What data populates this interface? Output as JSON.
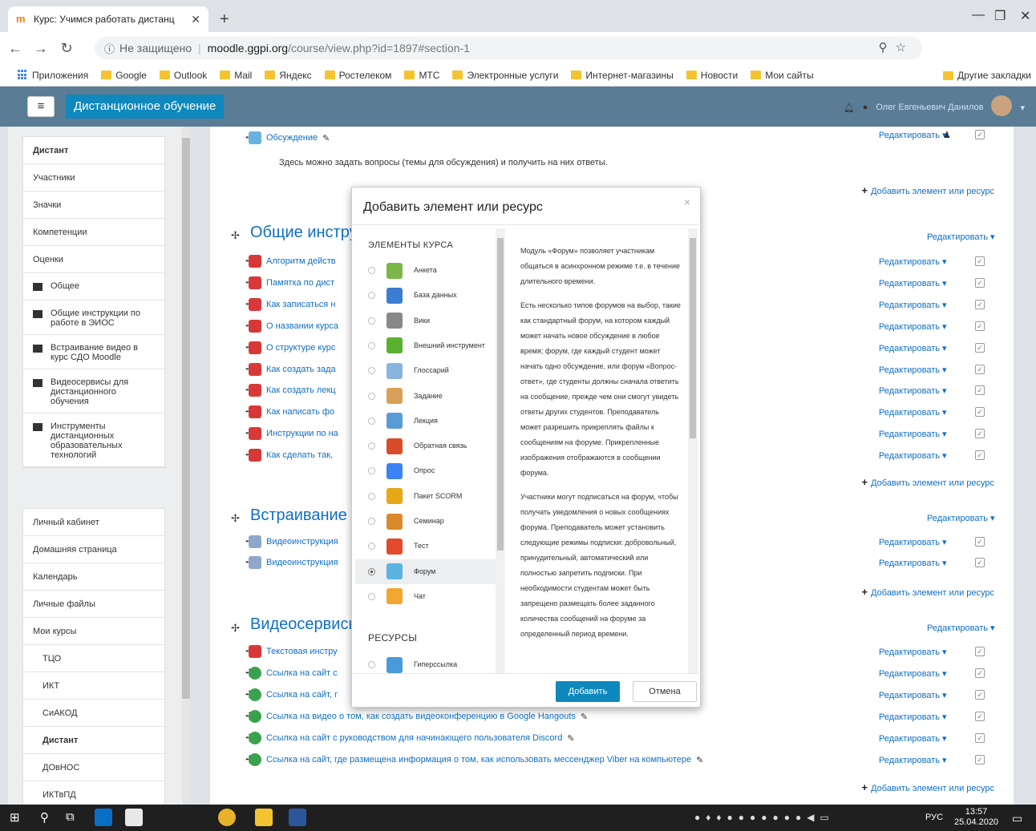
{
  "browser": {
    "tab_title": "Курс: Учимся работать дистанц",
    "new_tab": "+",
    "url_insecure": "Не защищено",
    "url_host": "moodle.ggpi.org",
    "url_path": "/course/view.php?id=1897#section-1"
  },
  "bookmarks": {
    "apps": "Приложения",
    "items": [
      "Google",
      "Outlook",
      "Mail",
      "Яндекс",
      "Ростелеком",
      "МТС",
      "Электронные услуги",
      "Интернет-магазины",
      "Новости",
      "Мои сайты"
    ],
    "other": "Другие закладки"
  },
  "moodle": {
    "site_name": "Дистанционное обучение",
    "user_name": "Олег Евгеньевич Данилов"
  },
  "drawer": {
    "group1": [
      "Дистант",
      "Участники",
      "Значки",
      "Компетенции",
      "Оценки",
      "Общее",
      "Общие инструкции по работе в ЭИОС",
      "Встраивание видео в курс СДО Moodle",
      "Видеосервисы для дистанционного обучения",
      "Инструменты дистанционных образовательных технологий"
    ],
    "group2": [
      "Личный кабинет",
      "Домашняя страница",
      "Календарь",
      "Личные файлы",
      "Мои курсы",
      "ТЦО",
      "ИКТ",
      "СиАКОД",
      "Дистант",
      "ДОвНОС",
      "ИКТвПД"
    ]
  },
  "content": {
    "forum_name": "Обсуждение",
    "forum_desc": "Здесь можно задать вопросы (темы для обсуждения) и получить на них ответы.",
    "edit": "Редактировать",
    "add_resource": "Добавить элемент или ресурс",
    "sections": [
      "Общие инстру",
      "Встраивание",
      "Видеосервисы"
    ],
    "section1_items": [
      "Алгоритм действ",
      "Памятка по дист",
      "Как записаться н",
      "О названии курса",
      "О структуре курс",
      "Как создать зада",
      "Как создать лекц",
      "Как написать фо",
      "Инструкции по на",
      "Как сделать так,"
    ],
    "section2_items": [
      "Видеоинструкция",
      "Видеоинструкция"
    ],
    "section3_items": [
      "Текстовая инстру",
      "Ссылка на сайт с",
      "Ссылка на сайт, г",
      "Ссылка на видео о том, как создать видеоконференцию в Google Hangouts",
      "Ссылка на сайт с руководством для начинающего пользователя Discord",
      "Ссылка на сайт, где размещена информация о том, как использовать мессенджер Viber на компьютере"
    ]
  },
  "modal": {
    "title": "Добавить элемент или ресурс",
    "close": "×",
    "cat_activities": "ЭЛЕМЕНТЫ КУРСА",
    "cat_resources": "РЕСУРСЫ",
    "options": [
      "Анкета",
      "База данных",
      "Вики",
      "Внешний инструмент",
      "Глоссарий",
      "Задание",
      "Лекция",
      "Обратная связь",
      "Опрос",
      "Пакет SCORM",
      "Семинар",
      "Тест",
      "Форум",
      "Чат"
    ],
    "resource_options": [
      "Гиперссылка"
    ],
    "selected": "Форум",
    "help": [
      "Модуль «Форум» позволяет участникам общаться в асинхронном режиме т.е. в течение длительного времени.",
      "Есть несколько типов форумов на выбор, такие как стандартный форум, на котором каждый может начать новое обсуждение в любое время; форум, где каждый студент может начать одно обсуждение, или форум «Вопрос-ответ», где студенты должны сначала ответить на сообщение, прежде чем они смогут увидеть ответы других студентов. Преподаватель может разрешить прикреплять файлы к сообщениям на форуме. Прикрепленные изображения отображаются в сообщении форума.",
      "Участники могут подписаться на форум, чтобы получать уведомления о новых сообщениях форума. Преподаватель может установить следующие режимы подписки: добровольный, принудительный, автоматический или полностью запретить подписки. При необходимости студентам может быть запрещено размещать более заданного количества сообщений на форуме за определенный период времени."
    ],
    "add_button": "Добавить",
    "cancel_button": "Отмена"
  },
  "taskbar": {
    "lang": "РУС",
    "time": "13:57",
    "date": "25.04.2020"
  },
  "colors": {
    "moodle_nav": "#5a7c94",
    "site_button": "#0f88bd",
    "link": "#0f6fc5"
  }
}
